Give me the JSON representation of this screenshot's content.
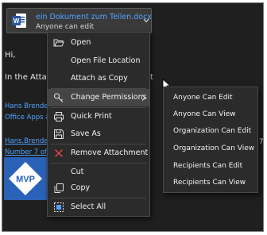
{
  "attachment": {
    "file_name": "ein Dokument zum Teilen.docx",
    "permission": "Anyone can edit"
  },
  "mail": {
    "greeting": "Hi,",
    "line2": "In the Attach",
    "line2_end": "t",
    "sig_name": "Hans Brender",
    "sig_line2": "Office Apps a",
    "sig_name2": "Hans.Brender",
    "sig_number": "Number 7 of",
    "trailing_digit": "7",
    "mvp_text": "MVP"
  },
  "menu": {
    "items": [
      {
        "label": "Open",
        "icon": "open-folder-icon"
      },
      {
        "label": "Open File Location",
        "icon": ""
      },
      {
        "label": "Attach as Copy",
        "icon": ""
      },
      {
        "label": "Change Permissions",
        "icon": "key-icon",
        "submenu": true
      },
      {
        "label": "Quick Print",
        "icon": "printer-icon"
      },
      {
        "label": "Save As",
        "icon": "save-icon"
      },
      {
        "label": "Remove Attachment",
        "icon": "remove-x-icon"
      },
      {
        "label": "Cut",
        "icon": ""
      },
      {
        "label": "Copy",
        "icon": "copy-icon"
      },
      {
        "label": "Select All",
        "icon": "select-all-icon"
      }
    ]
  },
  "submenu": {
    "items": [
      {
        "label": "Anyone Can Edit"
      },
      {
        "label": "Anyone Can View"
      },
      {
        "label": "Organization Can Edit"
      },
      {
        "label": "Organization Can View"
      },
      {
        "label": "Recipients Can Edit"
      },
      {
        "label": "Recipients Can View"
      }
    ]
  },
  "colors": {
    "background": "#1f1f1f",
    "menu": "#2b2b2b",
    "link": "#4fa3ff",
    "word_blue": "#2b579a",
    "remove_red": "#e8424c"
  }
}
